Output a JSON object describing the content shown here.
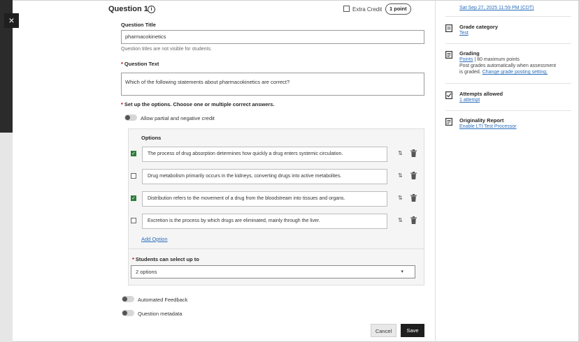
{
  "close_label": "×",
  "question": {
    "title": "Question 1",
    "info_glyph": "i",
    "extra_credit_label": "Extra Credit",
    "points_label": "1 point",
    "title_field_label": "Question Title",
    "title_field_value": "pharmacokinetics",
    "title_helper": "Question titles are not visible for students.",
    "text_field_label": "Question Text",
    "text_field_value": "Which of the following statements about pharmacokinetics are correct?",
    "setup_label": "Set up the options. Choose one or multiple correct answers.",
    "partial_credit_label": "Allow partial and negative credit",
    "required_mark": "*"
  },
  "options_panel": {
    "header": "Options",
    "items": [
      {
        "text": "The process of drug absorption determines how quickly a drug enters systemic circulation.",
        "correct": true
      },
      {
        "text": "Drug metabolism primarily occurs in the kidneys, converting drugs into active metabolites.",
        "correct": false
      },
      {
        "text": "Distribution refers to the movement of a drug from the bloodstream into tissues and organs.",
        "correct": true
      },
      {
        "text": "Excretion is the process by which drugs are eliminated, mainly through the liver.",
        "correct": false
      }
    ],
    "add_option_label": "Add Option",
    "select_label": "Students can select up to",
    "select_value": "2 options",
    "sort_glyph": "⇅",
    "check_glyph": "✓",
    "caret_glyph": "▾"
  },
  "toggles": {
    "automated_feedback": "Automated Feedback",
    "question_metadata": "Question metadata"
  },
  "footer": {
    "cancel_label": "Cancel",
    "save_label": "Save"
  },
  "sidebar": {
    "due_date_link": "Sat Sep 27, 2025 11:59 PM (CDT)",
    "grade_category_title": "Grade category",
    "grade_category_link": "Test",
    "grading_title": "Grading",
    "grading_points_link": "Points",
    "grading_points_text": "| 80 maximum points",
    "grading_post_text": "Post grades automatically when assessment",
    "grading_is_graded_text": "is graded.",
    "grading_change_link": "Change grade posting setting.",
    "attempts_title": "Attempts allowed",
    "attempts_link": "1 attempt",
    "originality_title": "Originality Report",
    "originality_link": "Enable LTI Test Processor"
  },
  "colors": {
    "accent_link": "#2a6ebb",
    "check_green": "#2d7d3a",
    "save_bg": "#1f1f1f"
  }
}
